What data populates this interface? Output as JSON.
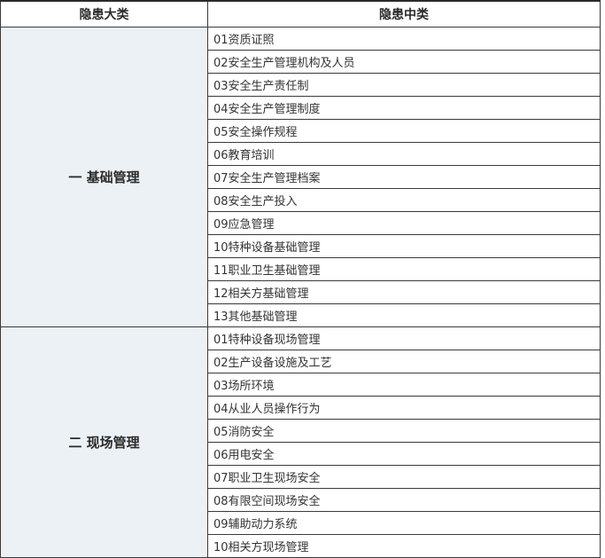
{
  "headers": {
    "major": "隐患大类",
    "middle": "隐患中类"
  },
  "groups": [
    {
      "category": "一  基础管理",
      "items": [
        "01资质证照",
        "02安全生产管理机构及人员",
        "03安全生产责任制",
        "04安全生产管理制度",
        "05安全操作规程",
        "06教育培训",
        "07安全生产管理档案",
        "08安全生产投入",
        "09应急管理",
        "10特种设备基础管理",
        "11职业卫生基础管理",
        "12相关方基础管理",
        "13其他基础管理"
      ]
    },
    {
      "category": "二  现场管理",
      "items": [
        "01特种设备现场管理",
        "02生产设备设施及工艺",
        "03场所环境",
        "04从业人员操作行为",
        "05消防安全",
        "06用电安全",
        "07职业卫生现场安全",
        "08有限空间现场安全",
        "09辅助动力系统",
        "10相关方现场管理"
      ]
    }
  ],
  "colors": {
    "category_cell_bg": "#ecf1f6",
    "border": "#3a3a3a"
  }
}
